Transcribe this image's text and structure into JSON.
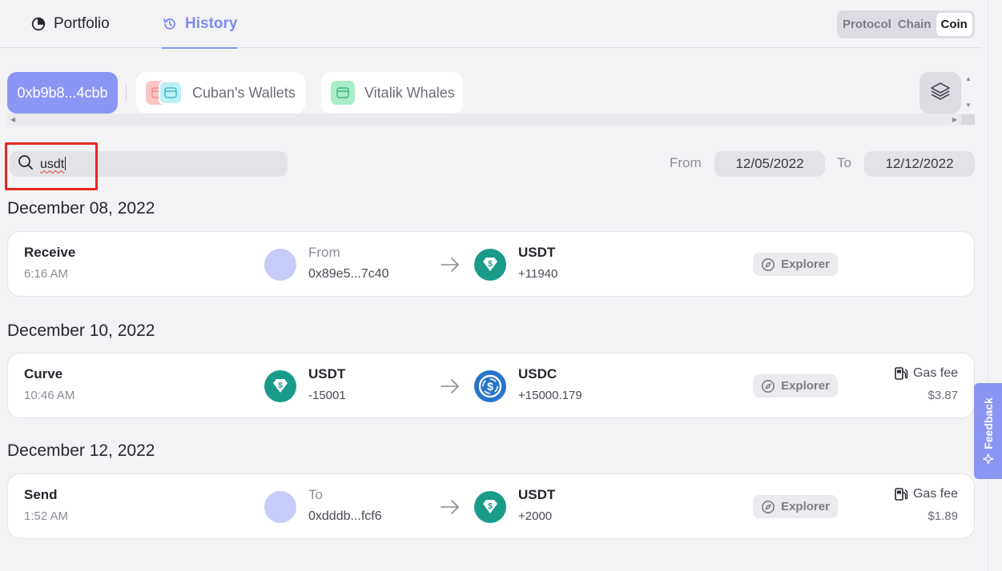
{
  "tabs": [
    {
      "label": "Portfolio",
      "icon": "pie-chart-icon",
      "active": false
    },
    {
      "label": "History",
      "icon": "history-clock-icon",
      "active": true
    }
  ],
  "view_toggle": {
    "options": [
      "Protocol",
      "Chain",
      "Coin"
    ],
    "selected": "Coin"
  },
  "wallets": {
    "selected": "0xb9b8...4cbb",
    "groups": [
      {
        "label": "Cuban's Wallets",
        "icons": [
          "wallet-icon",
          "wallet-icon"
        ]
      },
      {
        "label": "Vitalik Whales",
        "icons": [
          "wallet-icon"
        ]
      }
    ]
  },
  "search": {
    "value": "usdt"
  },
  "date_range": {
    "from_label": "From",
    "from_value": "12/05/2022",
    "to_label": "To",
    "to_value": "12/12/2022"
  },
  "history": [
    {
      "date": "December 08, 2022",
      "tx": {
        "type": "Receive",
        "time": "6:16 AM",
        "left_label": "From",
        "left_value": "0x89e5...7c40",
        "left_icon": "avatar",
        "right_label": "USDT",
        "right_value": "+11940",
        "right_icon": "usdt-icon",
        "explorer": "Explorer"
      }
    },
    {
      "date": "December 10, 2022",
      "tx": {
        "type": "Curve",
        "time": "10:46 AM",
        "left_label": "USDT",
        "left_value": "-15001",
        "left_icon": "usdt-icon",
        "right_label": "USDC",
        "right_value": "+15000.179",
        "right_icon": "usdc-icon",
        "explorer": "Explorer",
        "gas_label": "Gas fee",
        "gas_value": "$3.87"
      }
    },
    {
      "date": "December 12, 2022",
      "tx": {
        "type": "Send",
        "time": "1:52 AM",
        "left_label": "To",
        "left_value": "0xdddb...fcf6",
        "left_icon": "avatar",
        "right_label": "USDT",
        "right_value": "+2000",
        "right_icon": "usdt-icon",
        "explorer": "Explorer",
        "gas_label": "Gas fee",
        "gas_value": "$1.89"
      }
    }
  ],
  "feedback": {
    "label": "Feedback"
  },
  "colors": {
    "accent": "#8a96f4",
    "usdt": "#1a9b8a",
    "usdc": "#2775ca",
    "highlight": "#e8261f"
  }
}
